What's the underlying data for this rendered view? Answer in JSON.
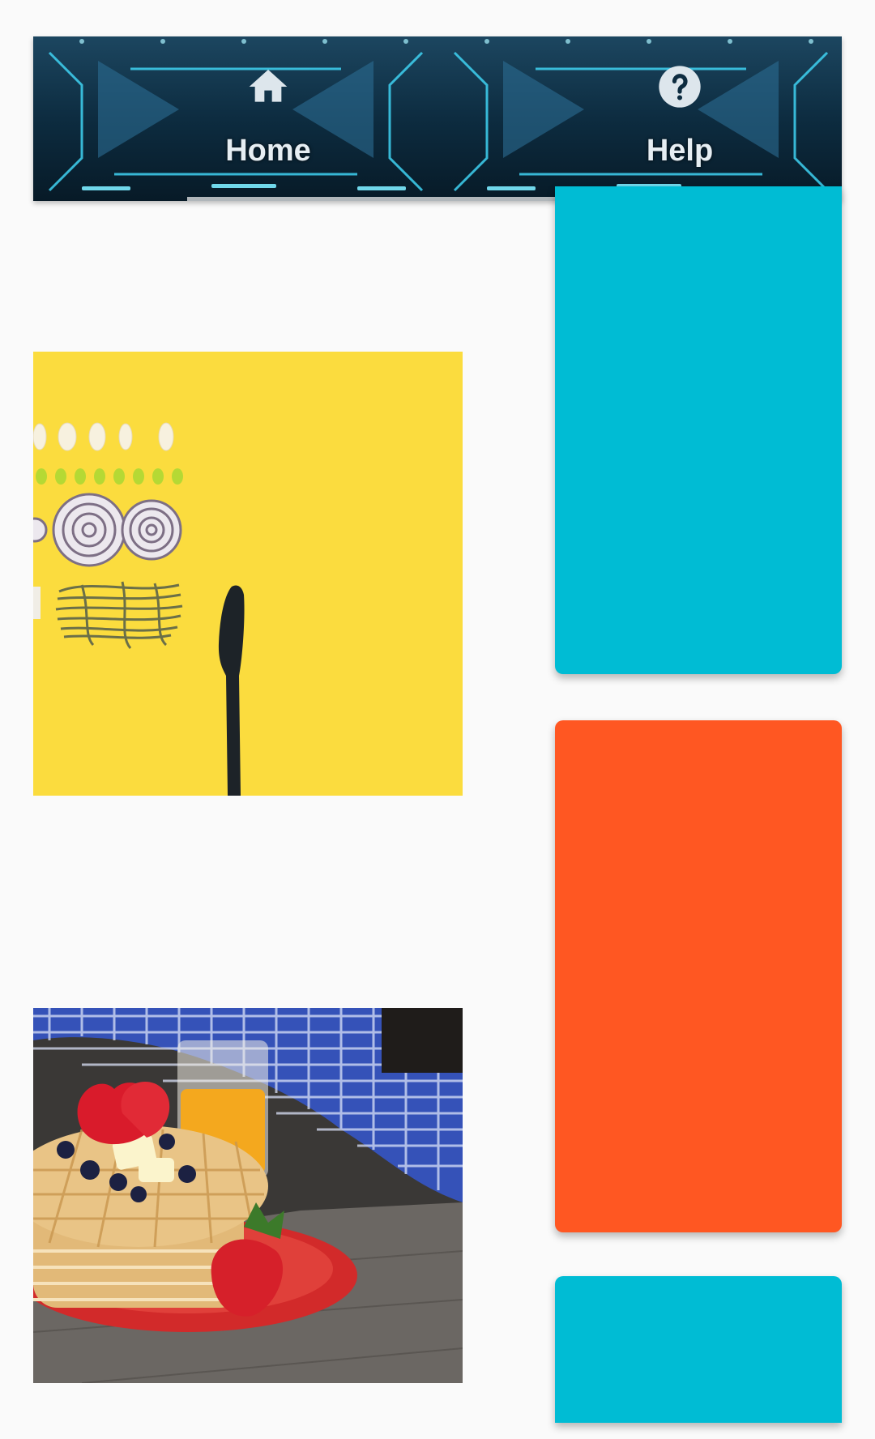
{
  "tabs": [
    {
      "label": "Home",
      "icon": "home-icon",
      "selected": true
    },
    {
      "label": "Help",
      "icon": "help-circle-icon",
      "selected": false
    }
  ],
  "images": {
    "top": {
      "subject": "ingredients-on-yellow"
    },
    "bottom": {
      "subject": "waffles-with-berries"
    }
  },
  "cards": [
    {
      "color": "#00bcd4"
    },
    {
      "color": "#ff5722"
    },
    {
      "color": "#00bcd4"
    }
  ],
  "colors": {
    "background": "#fafafa",
    "header": "#0b2a3e",
    "header_text": "#e6eef3",
    "accent_cyan": "#00bcd4",
    "accent_orange": "#ff5722"
  }
}
